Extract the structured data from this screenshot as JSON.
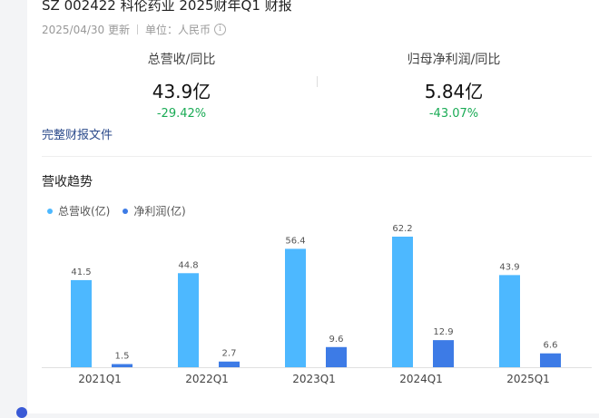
{
  "header": {
    "title": "SZ 002422 科伦药业 2025财年Q1 财报",
    "date": "2025/04/30 更新",
    "unit": "单位：人民币"
  },
  "metrics": [
    {
      "label": "总营收/同比",
      "value": "43.9亿",
      "change": "-29.42%"
    },
    {
      "label": "归母净利润/同比",
      "value": "5.84亿",
      "change": "-43.07%"
    }
  ],
  "link_text": "完整财报文件",
  "section_title": "营收趋势",
  "colors": {
    "revenue": "#4db8ff",
    "profit": "#3d7be6",
    "positive_change": "#1aab55"
  },
  "chart_data": {
    "type": "bar",
    "categories": [
      "2021Q1",
      "2022Q1",
      "2023Q1",
      "2024Q1",
      "2025Q1"
    ],
    "series": [
      {
        "name": "总营收(亿)",
        "values": [
          41.5,
          44.8,
          56.4,
          62.2,
          43.9
        ]
      },
      {
        "name": "净利润(亿)",
        "values": [
          1.5,
          2.7,
          9.6,
          12.9,
          6.6
        ]
      }
    ],
    "ylim": [
      0,
      62.2
    ],
    "legend": "top-left",
    "grid": false
  }
}
